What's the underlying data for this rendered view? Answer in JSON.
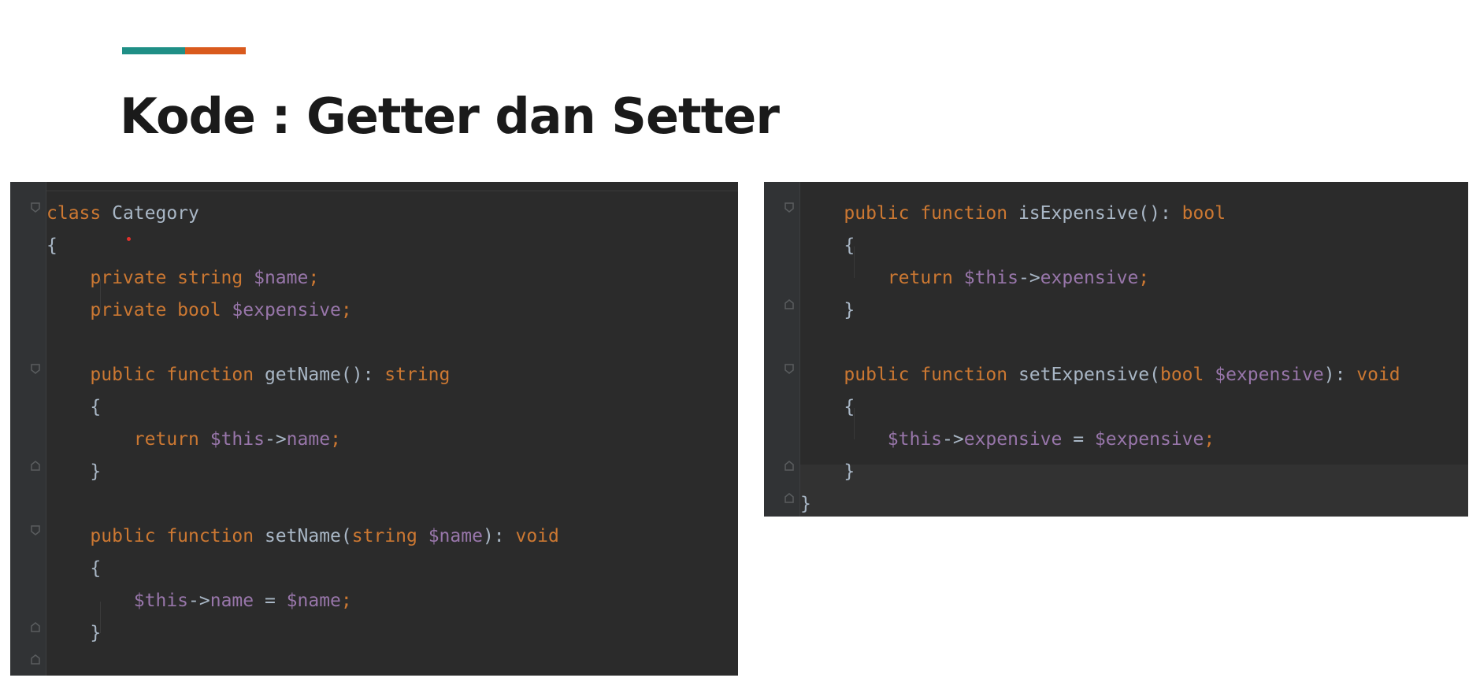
{
  "slide": {
    "title": "Kode : Getter dan Setter",
    "accent_colors": [
      "#1f8f86",
      "#d95a1d"
    ]
  },
  "colors": {
    "editor_bg": "#2b2b2b",
    "keyword": "#cc7832",
    "variable": "#9876aa",
    "text": "#a9b7c6"
  },
  "left_panel": {
    "lines": [
      {
        "indent": "",
        "tokens": [
          {
            "t": "class ",
            "c": "kw"
          },
          {
            "t": "Category",
            "c": "cls"
          }
        ]
      },
      {
        "indent": "",
        "tokens": [
          {
            "t": "{",
            "c": "plain"
          }
        ]
      },
      {
        "indent": "    ",
        "tokens": [
          {
            "t": "private ",
            "c": "kw"
          },
          {
            "t": "string ",
            "c": "ty"
          },
          {
            "t": "$name",
            "c": "var"
          },
          {
            "t": ";",
            "c": "kw"
          }
        ]
      },
      {
        "indent": "    ",
        "tokens": [
          {
            "t": "private ",
            "c": "kw"
          },
          {
            "t": "bool ",
            "c": "ty"
          },
          {
            "t": "$expensive",
            "c": "var"
          },
          {
            "t": ";",
            "c": "kw"
          }
        ]
      },
      {
        "indent": "",
        "tokens": []
      },
      {
        "indent": "    ",
        "tokens": [
          {
            "t": "public ",
            "c": "kw"
          },
          {
            "t": "function ",
            "c": "kw"
          },
          {
            "t": "getName",
            "c": "fn"
          },
          {
            "t": "(): ",
            "c": "plain"
          },
          {
            "t": "string",
            "c": "ty"
          }
        ]
      },
      {
        "indent": "    ",
        "tokens": [
          {
            "t": "{",
            "c": "plain"
          }
        ]
      },
      {
        "indent": "        ",
        "tokens": [
          {
            "t": "return ",
            "c": "kw"
          },
          {
            "t": "$this",
            "c": "var"
          },
          {
            "t": "->",
            "c": "plain"
          },
          {
            "t": "name",
            "c": "var"
          },
          {
            "t": ";",
            "c": "kw"
          }
        ]
      },
      {
        "indent": "    ",
        "tokens": [
          {
            "t": "}",
            "c": "plain"
          }
        ]
      },
      {
        "indent": "",
        "tokens": []
      },
      {
        "indent": "    ",
        "tokens": [
          {
            "t": "public ",
            "c": "kw"
          },
          {
            "t": "function ",
            "c": "kw"
          },
          {
            "t": "setName",
            "c": "fn"
          },
          {
            "t": "(",
            "c": "plain"
          },
          {
            "t": "string ",
            "c": "ty"
          },
          {
            "t": "$name",
            "c": "var"
          },
          {
            "t": "): ",
            "c": "plain"
          },
          {
            "t": "void",
            "c": "ty"
          }
        ]
      },
      {
        "indent": "    ",
        "tokens": [
          {
            "t": "{",
            "c": "plain"
          }
        ]
      },
      {
        "indent": "        ",
        "tokens": [
          {
            "t": "$this",
            "c": "var"
          },
          {
            "t": "->",
            "c": "plain"
          },
          {
            "t": "name",
            "c": "var"
          },
          {
            "t": " = ",
            "c": "plain"
          },
          {
            "t": "$name",
            "c": "var"
          },
          {
            "t": ";",
            "c": "kw"
          }
        ]
      },
      {
        "indent": "    ",
        "tokens": [
          {
            "t": "}",
            "c": "plain"
          }
        ]
      }
    ]
  },
  "right_panel": {
    "lines": [
      {
        "indent": "    ",
        "tokens": [
          {
            "t": "public ",
            "c": "kw"
          },
          {
            "t": "function ",
            "c": "kw"
          },
          {
            "t": "isExpensive",
            "c": "fn"
          },
          {
            "t": "(): ",
            "c": "plain"
          },
          {
            "t": "bool",
            "c": "ty"
          }
        ]
      },
      {
        "indent": "    ",
        "tokens": [
          {
            "t": "{",
            "c": "plain"
          }
        ]
      },
      {
        "indent": "        ",
        "tokens": [
          {
            "t": "return ",
            "c": "kw"
          },
          {
            "t": "$this",
            "c": "var"
          },
          {
            "t": "->",
            "c": "plain"
          },
          {
            "t": "expensive",
            "c": "var"
          },
          {
            "t": ";",
            "c": "kw"
          }
        ]
      },
      {
        "indent": "    ",
        "tokens": [
          {
            "t": "}",
            "c": "plain"
          }
        ]
      },
      {
        "indent": "",
        "tokens": []
      },
      {
        "indent": "    ",
        "tokens": [
          {
            "t": "public ",
            "c": "kw"
          },
          {
            "t": "function ",
            "c": "kw"
          },
          {
            "t": "setExpensive",
            "c": "fn"
          },
          {
            "t": "(",
            "c": "plain"
          },
          {
            "t": "bool ",
            "c": "ty"
          },
          {
            "t": "$expensive",
            "c": "var"
          },
          {
            "t": "): ",
            "c": "plain"
          },
          {
            "t": "void",
            "c": "ty"
          }
        ]
      },
      {
        "indent": "    ",
        "tokens": [
          {
            "t": "{",
            "c": "plain"
          }
        ]
      },
      {
        "indent": "        ",
        "tokens": [
          {
            "t": "$this",
            "c": "var"
          },
          {
            "t": "->",
            "c": "plain"
          },
          {
            "t": "expensive",
            "c": "var"
          },
          {
            "t": " = ",
            "c": "plain"
          },
          {
            "t": "$expensive",
            "c": "var"
          },
          {
            "t": ";",
            "c": "kw"
          }
        ]
      },
      {
        "indent": "    ",
        "tokens": [
          {
            "t": "}",
            "c": "plain"
          }
        ]
      },
      {
        "indent": "",
        "tokens": [
          {
            "t": "}",
            "c": "plain"
          }
        ]
      }
    ]
  }
}
